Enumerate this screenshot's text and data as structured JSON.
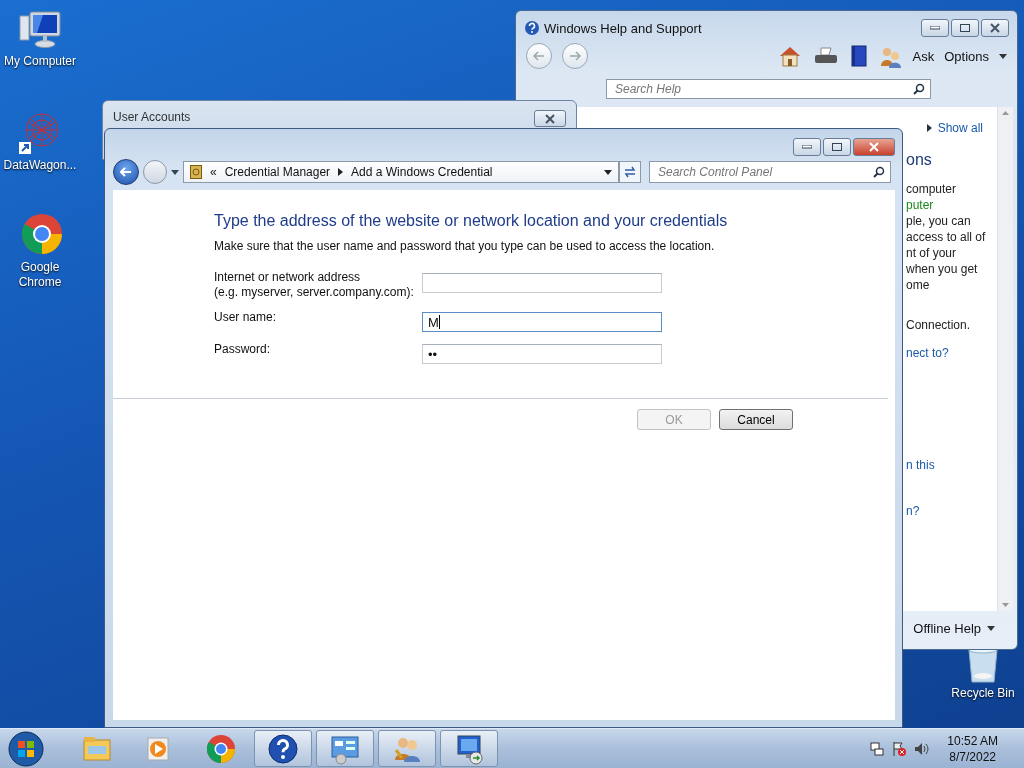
{
  "desktop_icons": [
    {
      "label": "My Computer",
      "kind": "computer"
    },
    {
      "label": "DataWagon...",
      "kind": "network"
    },
    {
      "label": "Google\nChrome",
      "kind": "chrome"
    },
    {
      "label": "Recycle Bin",
      "kind": "bin"
    }
  ],
  "help_window": {
    "title": "Windows Help and Support",
    "ask": "Ask",
    "options": "Options",
    "search": {
      "placeholder": "Search Help"
    },
    "show_all": "Show all",
    "heading": "ons",
    "paragraphs": [
      [
        {
          "text": "computer",
          "kind": "text"
        },
        {
          "text": "puter",
          "kind": "green"
        },
        {
          "text": "ple, you can",
          "kind": "text"
        },
        {
          "text": "access to all of",
          "kind": "text"
        },
        {
          "text": "nt of your",
          "kind": "text"
        },
        {
          "text": "when you get",
          "kind": "text"
        },
        {
          "text": "ome",
          "kind": "text"
        }
      ],
      [
        {
          "text": "Connection.",
          "kind": "text"
        }
      ],
      [
        {
          "text": "nect to?",
          "kind": "link"
        }
      ],
      [
        {
          "text": "n this",
          "kind": "link"
        }
      ],
      [
        {
          "text": "n?",
          "kind": "link"
        }
      ]
    ],
    "footer": "Offline Help"
  },
  "back_window": {
    "title": "User Accounts"
  },
  "credential_window": {
    "overflow": "«",
    "breadcrumb": [
      "Credential Manager",
      "Add a Windows Credential"
    ],
    "search": {
      "placeholder": "Search Control Panel"
    },
    "heading": "Type the address of the website or network location and your credentials",
    "description": "Make sure that the user name and password that you type can be used to access the location.",
    "fields": [
      {
        "label": [
          "Internet or network address",
          "(e.g. myserver, server.company.com):"
        ],
        "focused": false
      },
      {
        "label": [
          "User name:"
        ],
        "value": "M",
        "focused": true
      },
      {
        "label": [
          "Password:"
        ],
        "value": "••",
        "focused": false
      }
    ],
    "buttons": [
      {
        "label": "OK",
        "disabled": true
      },
      {
        "label": "Cancel",
        "disabled": false
      }
    ]
  },
  "taskbar": {
    "apps": [
      {
        "kind": "explorer",
        "running": false
      },
      {
        "kind": "media",
        "running": false
      },
      {
        "kind": "chrome",
        "running": false
      },
      {
        "kind": "help",
        "running": true
      },
      {
        "kind": "control",
        "running": true
      },
      {
        "kind": "users",
        "running": true
      },
      {
        "kind": "remote",
        "running": true
      }
    ],
    "time": "10:52 AM",
    "date": "8/7/2022"
  }
}
